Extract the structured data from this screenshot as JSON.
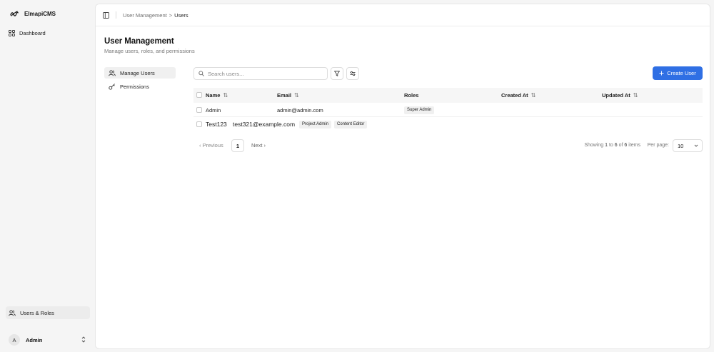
{
  "sidebar": {
    "brand": "ElmapiCMS",
    "nav": [
      {
        "label": "Dashboard",
        "icon": "grid-icon"
      },
      {
        "label": "Users & Roles",
        "icon": "users-icon"
      }
    ],
    "user": {
      "initial": "A",
      "name": "Admin"
    }
  },
  "breadcrumb": {
    "parent": "User Management",
    "current": "Users"
  },
  "page": {
    "title": "User Management",
    "subtitle": "Manage users, roles, and permissions"
  },
  "subnav": [
    {
      "label": "Manage Users",
      "icon": "users-icon",
      "active": true
    },
    {
      "label": "Permissions",
      "icon": "key-icon",
      "active": false
    }
  ],
  "toolbar": {
    "search_placeholder": "Search users...",
    "create_label": "Create User"
  },
  "table": {
    "columns": [
      "Name",
      "Email",
      "Roles",
      "Created At",
      "Updated At"
    ],
    "rows": [
      {
        "name": "Admin",
        "email": "admin@admin.com",
        "roles": [
          "Super Admin"
        ]
      },
      {
        "name": "Test123",
        "email": "test321@example.com",
        "roles": [
          "Project Admin",
          "Content Editor"
        ]
      }
    ]
  },
  "pagination": {
    "prev": "Previous",
    "page": "1",
    "next": "Next",
    "showing_prefix": "Showing ",
    "from": "1",
    "to_word": " to ",
    "to": "6",
    "of_word": " of ",
    "total": "6",
    "suffix": " items",
    "per_page_label": "Per page:",
    "per_page_value": "10"
  },
  "colors": {
    "accent": "#2f6fe4",
    "background": "#f5f5f5",
    "panel": "#ffffff"
  }
}
